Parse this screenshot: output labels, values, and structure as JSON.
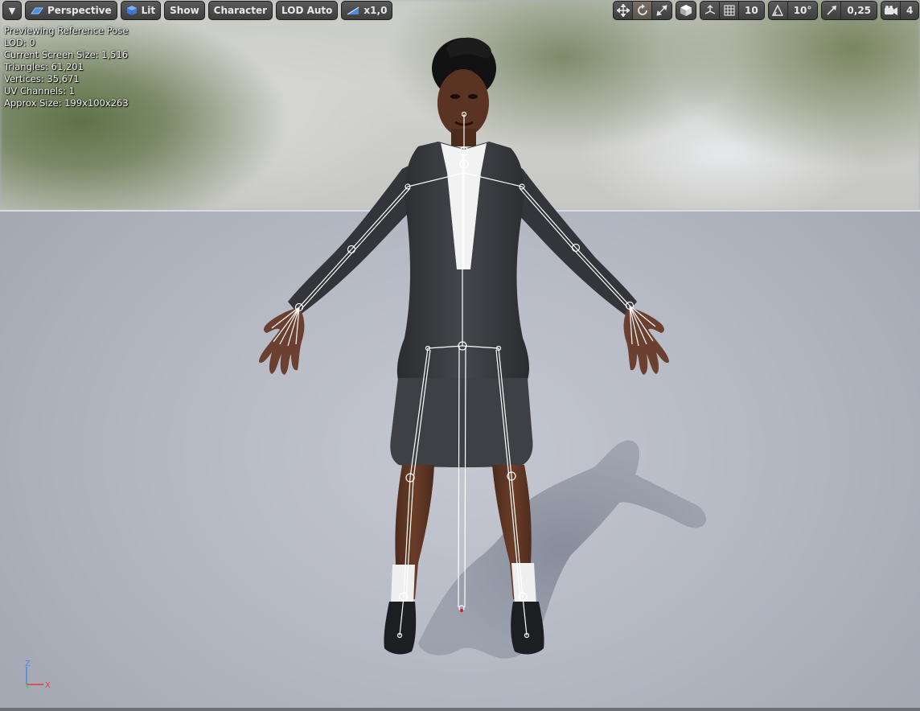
{
  "toolbar_left": {
    "menu_label": "▾",
    "perspective_label": "Perspective",
    "lit_label": "Lit",
    "show_label": "Show",
    "character_label": "Character",
    "lod_label": "LOD Auto",
    "speed_label": "x1,0"
  },
  "toolbar_right": {
    "grid_snap_value": "10",
    "rotation_snap_value": "10°",
    "scale_snap_value": "0,25",
    "camera_speed_value": "4"
  },
  "stats": {
    "line1": "Previewing Reference Pose",
    "line2": "LOD: 0",
    "line3": "Current Screen Size: 1,516",
    "line4": "Triangles: 61,201",
    "line5": "Vertices: 35,671",
    "line6": "UV Channels: 1",
    "line7": "Approx Size: 199x100x263"
  },
  "axis": {
    "z": "Z",
    "x": "X"
  },
  "colors": {
    "toolbar_bg": "#4a4a4a",
    "toolbar_active": "#6b625a",
    "axis_x": "#e23b3b",
    "axis_y": "#3bd24a",
    "axis_z": "#4a8de0",
    "floor": "#b8bcc6",
    "bones": "#ffffff"
  }
}
